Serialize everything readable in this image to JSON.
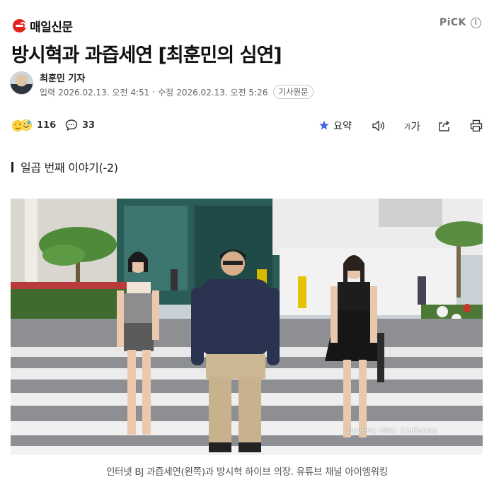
{
  "header": {
    "brand_name": "매일신문",
    "pick_label": "PiCK",
    "info_glyph": "i"
  },
  "article": {
    "headline": "방시혁과 과즙세연 [최훈민의 심연]",
    "reporter": "최훈민 기자",
    "published_label": "입력",
    "published": "2026.02.13. 오전 4:51",
    "separator": "·",
    "updated_label": "수정",
    "updated": "2026.02.13. 오전 5:26",
    "original_button": "기사원문",
    "subhead": "일곱 번째 이야기(-2)",
    "caption": "인터넷 BJ 과즙세연(왼쪽)과 방시혁 하이브 의장. 유튜브 채널 아이엠워킹",
    "photo_watermark": "Beverly Hills, California"
  },
  "actions": {
    "reaction_count": "116",
    "comment_count": "33",
    "summary_label": "요약",
    "font_small": "가",
    "font_large": "가"
  },
  "icons": {
    "brand": "brand-logo-icon",
    "reaction": "reaction-emoji-icon",
    "comment": "comment-bubble-icon",
    "summary": "ai-summary-icon",
    "speaker": "speaker-icon",
    "share": "share-icon",
    "print": "print-icon"
  },
  "colors": {
    "brand_red": "#e2231a",
    "summary_accent": "#3b5bdb",
    "text_gray": "#666666"
  }
}
